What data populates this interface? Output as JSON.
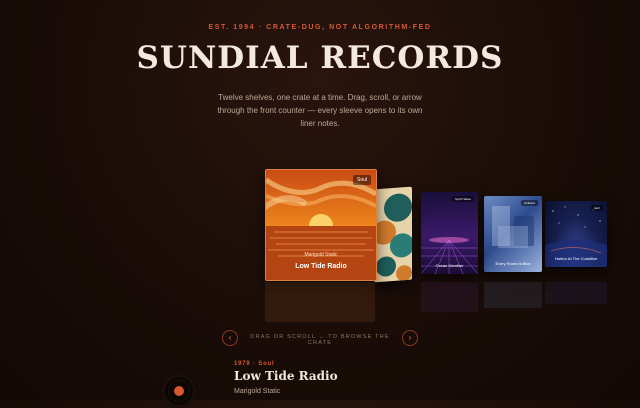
{
  "header": {
    "eyebrow": "EST. 1994 · CRATE-DUG, NOT ALGORITHM-FED",
    "title": "SUNDIAL RECORDS",
    "subtitle": "Twelve shelves, one crate at a time. Drag, scroll, or arrow through the front counter — every sleeve opens to its own liner notes."
  },
  "crate": {
    "active": {
      "genre": "Soul",
      "artist": "Marigold Static",
      "album": "Low Tide Radio"
    },
    "sleeves": [
      {
        "tag": "",
        "caption": ""
      },
      {
        "tag": "Synth Wave",
        "caption": "Ocean Weather"
      },
      {
        "tag": "Ambient",
        "caption": "Every Room is Blue"
      },
      {
        "tag": "Jazz",
        "caption": "Harbor At The Coastline"
      }
    ]
  },
  "controls": {
    "prev_icon": "chevron-left-icon",
    "next_icon": "chevron-right-icon",
    "prev_glyph": "‹",
    "next_glyph": "›",
    "hint": "DRAG OR SCROLL ← TO BROWSE THE CRATE"
  },
  "now_playing": {
    "year_genre": "1979 · Soul",
    "album": "Low Tide Radio",
    "artist": "Marigold Static"
  },
  "colors": {
    "accent": "#d65a35",
    "background": "#1a0d08"
  }
}
